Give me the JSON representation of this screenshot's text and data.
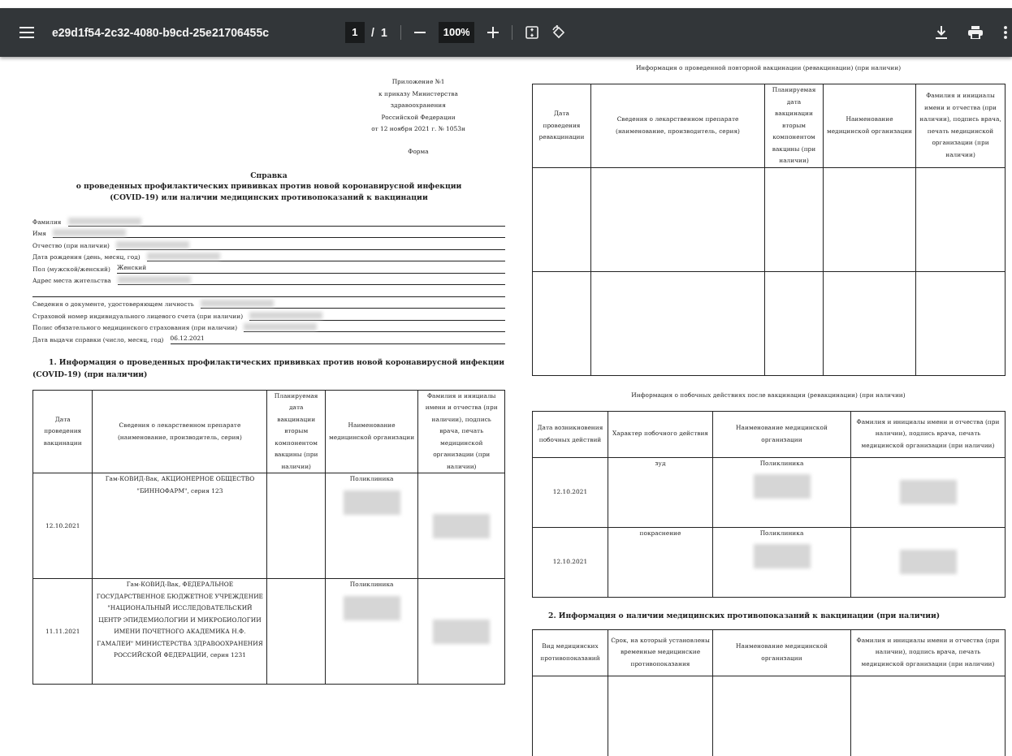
{
  "toolbar": {
    "filename": "e29d1f54-2c32-4080-b9cd-25e21706455c",
    "page_current": "1",
    "page_separator": "/",
    "page_total": "1",
    "zoom": "100%"
  },
  "document": {
    "left": {
      "header_lines": [
        "Приложение №1",
        "к приказу Министерства",
        "здравоохранения",
        "Российской Федерации",
        "от 12 ноября 2021 г. № 1053н"
      ],
      "form_label": "Форма",
      "title": "Справка",
      "subtitle": "о проведенных профилактических прививках против новой коронавирусной инфекции (COVID-19) или наличии медицинских противопоказаний к вакцинации",
      "fields": [
        {
          "kind": "field",
          "label": "Фамилия",
          "redacted": true
        },
        {
          "kind": "field",
          "label": "Имя",
          "redacted": true
        },
        {
          "kind": "field",
          "label": "Отчество (при наличии)",
          "redacted": true
        },
        {
          "kind": "field",
          "label": "Дата рождения (день, месяц, год)",
          "redacted": true
        },
        {
          "kind": "field",
          "label": "Пол (мужской/женский)",
          "value": "Женский",
          "redacted": false
        },
        {
          "kind": "field",
          "label": "Адрес места жительства",
          "redacted": true
        },
        {
          "kind": "blank"
        },
        {
          "kind": "field",
          "label": "Сведения о документе, удостоверяющем личность",
          "redacted": true
        },
        {
          "kind": "field",
          "label": "Страховой номер индивидуального лицевого счета (при наличии)",
          "redacted": true
        },
        {
          "kind": "field",
          "label": "Полис обязательного медицинского страхования (при наличии)",
          "redacted": true
        },
        {
          "kind": "field",
          "label": "Дата выдачи справки (число, месяц, год)",
          "value": "06.12.2021",
          "redacted": false
        }
      ],
      "section_title": "1. Информация о проведенных профилактических прививках против новой коронавирусной инфекции (COVID-19) (при наличии)",
      "table": {
        "columns": [
          "Дата проведения вакцинации",
          "Сведения о лекарственном препарате (наименование, производитель, серия)",
          "Планируемая дата вакцинации вторым компонентом вакцины (при наличии)",
          "Наименование медицинской организации",
          "Фамилия и инициалы имени и отчества (при наличии), подпись врача, печать медицинской организации (при наличии)"
        ],
        "rows": [
          {
            "cells": [
              {
                "text": "12.10.2021",
                "redacted": false
              },
              {
                "text": "Гам-КОВИД-Вак, АКЦИОНЕРНОЕ ОБЩЕСТВО \"БИННОФАРМ\", серия 123",
                "redacted": false
              },
              {
                "redacted": false
              },
              {
                "text": "Поликлиника",
                "redacted": true
              },
              {
                "redacted": true
              }
            ]
          },
          {
            "cells": [
              {
                "text": "11.11.2021",
                "redacted": false
              },
              {
                "text": "Гам-КОВИД-Вак, ФЕДЕРАЛЬНОЕ ГОСУДАРСТВЕННОЕ БЮДЖЕТНОЕ УЧРЕЖДЕНИЕ \"НАЦИОНАЛЬНЫЙ ИССЛЕДОВАТЕЛЬСКИЙ ЦЕНТР ЭПИДЕМИОЛОГИИ И МИКРОБИОЛОГИИ ИМЕНИ ПОЧЕТНОГО АКАДЕМИКА Н.Ф. ГАМАЛЕИ\" МИНИСТЕРСТВА ЗДРАВООХРАНЕНИЯ РОССИЙСКОЙ ФЕДЕРАЦИИ, серия 1231",
                "redacted": false
              },
              {
                "redacted": false
              },
              {
                "text": "Поликлиника",
                "redacted": true
              },
              {
                "redacted": true
              }
            ]
          }
        ]
      }
    },
    "right": {
      "revaccination": {
        "caption": "Информация о проведенной повторной вакцинации (ревакцинации) (при наличии)",
        "columns": [
          "Дата проведения ревакцинации",
          "Сведения о лекарственном препарате (наименование, производитель, серия)",
          "Планируемая дата вакцинации вторым компонентом вакцины (при наличии)",
          "Наименование медицинской организации",
          "Фамилия и инициалы имени и отчества (при наличии), подпись врача, печать медицинской организации (при наличии)"
        ],
        "rows": [
          {
            "cells": [
              {
                "redacted": false
              },
              {
                "redacted": false
              },
              {
                "redacted": false
              },
              {
                "redacted": false
              },
              {
                "redacted": false
              }
            ]
          },
          {
            "cells": [
              {
                "redacted": false
              },
              {
                "redacted": false
              },
              {
                "redacted": false
              },
              {
                "redacted": false
              },
              {
                "redacted": false
              }
            ]
          }
        ]
      },
      "side_effects": {
        "caption": "Информация о побочных действиях после вакцинации (ревакцинации) (при наличии)",
        "columns": [
          "Дата возникновения побочных действий",
          "Характер побочного действия",
          "Наименование медицинской организации",
          "Фамилия и инициалы имени и отчества (при наличии), подпись врача, печать медицинской организации (при наличии)"
        ],
        "rows": [
          {
            "cells": [
              {
                "text": "12.10.2021",
                "redacted": false
              },
              {
                "text": "зуд",
                "redacted": false
              },
              {
                "text": "Поликлиника",
                "redacted": true
              },
              {
                "redacted": true
              }
            ]
          },
          {
            "cells": [
              {
                "text": "12.10.2021",
                "redacted": false
              },
              {
                "text": "покраснение",
                "redacted": false
              },
              {
                "text": "Поликлиника",
                "redacted": true
              },
              {
                "redacted": true
              }
            ]
          }
        ]
      },
      "section_title": "2. Информация о наличии медицинских противопоказаний к вакцинации (при наличии)",
      "contraindications": {
        "columns": [
          "Вид медицинских противопоказаний",
          "Срок, на который установлены временные медицинские противопоказания",
          "Наименование медицинской организации",
          "Фамилия и инициалы имени и отчества (при наличии), подпись врача, печать медицинской организации (при наличии)"
        ],
        "rows": [
          {
            "cells": [
              {
                "redacted": false
              },
              {
                "redacted": false
              },
              {
                "redacted": false
              },
              {
                "redacted": false
              }
            ]
          }
        ]
      }
    }
  }
}
